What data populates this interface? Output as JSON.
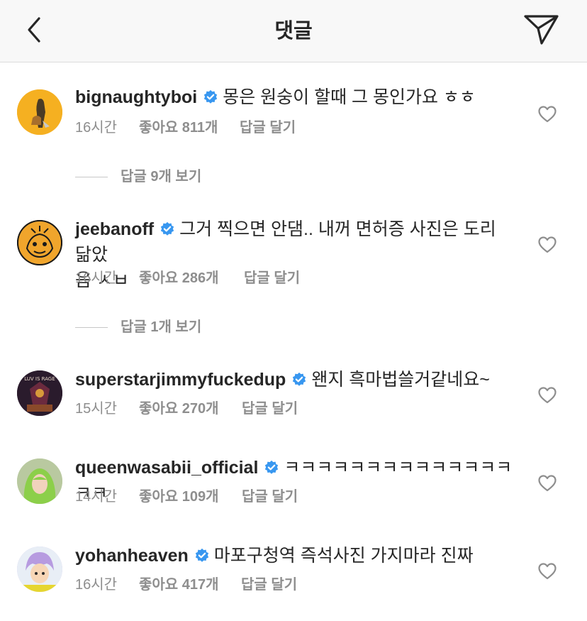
{
  "header": {
    "title": "댓글",
    "back_icon": "chevron-left-icon",
    "send_icon": "paper-plane-icon"
  },
  "colors": {
    "verified": "#3897f0",
    "text": "#262626",
    "muted": "#8e8e8e"
  },
  "comments": [
    {
      "username": "bignaughtyboi",
      "text": "몽은 원숭이 할때 그 몽인가요 ㅎㅎ",
      "time": "16시간",
      "likes": "좋아요 811개",
      "reply": "답글 달기",
      "view_replies": "답글 9개 보기"
    },
    {
      "username": "jeebanoff",
      "text": "그거 찍으면 안댐.. 내꺼 면허증 사진은 도리 닮았",
      "text_cont": "음 ㅅㅂ",
      "time": "16시간",
      "likes": "좋아요 286개",
      "reply": "답글 달기",
      "view_replies": "답글 1개 보기"
    },
    {
      "username": "superstarjimmyfuckedup",
      "text": "왠지 흑마법쓸거같네요~",
      "time": "15시간",
      "likes": "좋아요 270개",
      "reply": "답글 달기",
      "avatar_text": "LUV IS RAGE"
    },
    {
      "username": "queenwasabii_official",
      "text": "ㅋㅋㅋㅋㅋㅋㅋㅋㅋㅋㅋㅋㅋㅋㅋㅋ",
      "time": "14시간",
      "likes": "좋아요 109개",
      "reply": "답글 달기"
    },
    {
      "username": "yohanheaven",
      "text": "마포구청역 즉석사진 가지마라 진짜",
      "time": "16시간",
      "likes": "좋아요 417개",
      "reply": "답글 달기"
    }
  ]
}
